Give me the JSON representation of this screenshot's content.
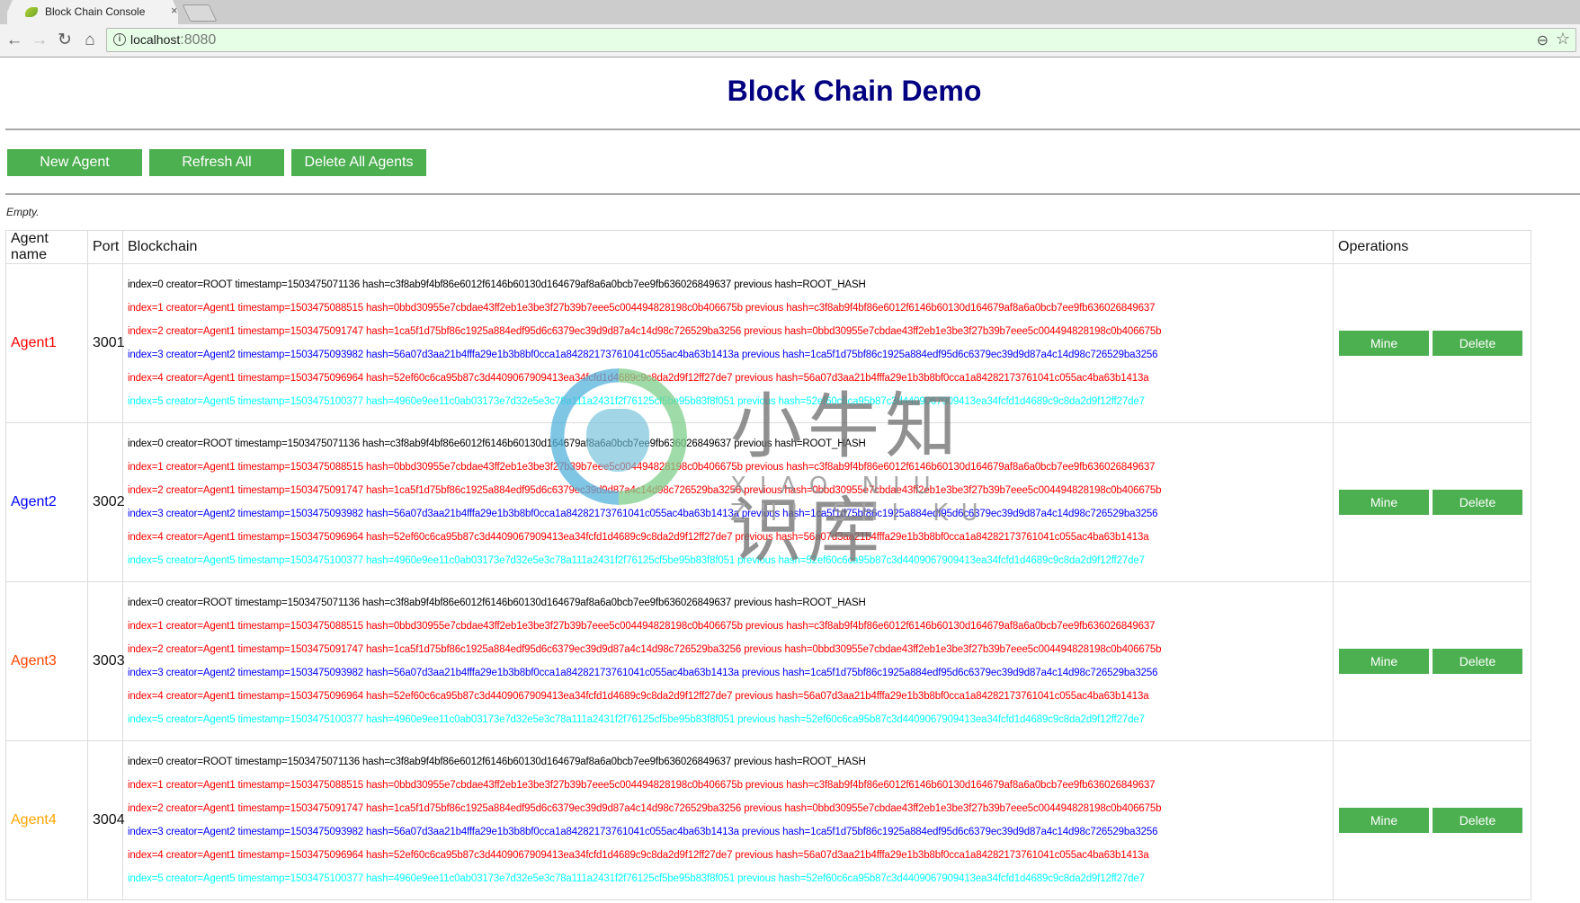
{
  "browser": {
    "tab_title": "Block Chain Console",
    "tab_close": "×",
    "url_host": "localhost",
    "url_port": ":8080",
    "icons": {
      "back": "←",
      "forward": "→",
      "reload": "↻",
      "home": "⌂",
      "info": "i",
      "zoom": "⊖",
      "star": "☆"
    }
  },
  "page": {
    "title": "Block Chain Demo",
    "buttons": {
      "new_agent": "New Agent",
      "refresh_all": "Refresh All",
      "delete_all": "Delete All Agents"
    },
    "status": "Empty."
  },
  "table": {
    "headers": {
      "name": "Agent name",
      "port": "Port",
      "blockchain": "Blockchain",
      "operations": "Operations"
    },
    "ops": {
      "mine": "Mine",
      "delete": "Delete"
    },
    "creator_colors": {
      "ROOT": "#000000",
      "Agent1": "#ff0000",
      "Agent2": "#0000ff",
      "Agent3": "#ff4500",
      "Agent4": "#ffa500",
      "Agent5": "#00ffff"
    },
    "agents": [
      {
        "name": "Agent1",
        "port": "3001",
        "color": "#ff0000"
      },
      {
        "name": "Agent2",
        "port": "3002",
        "color": "#0000ff"
      },
      {
        "name": "Agent3",
        "port": "3003",
        "color": "#ff4500"
      },
      {
        "name": "Agent4",
        "port": "3004",
        "color": "#ffa500"
      }
    ],
    "blockchain": [
      {
        "creator": "ROOT",
        "text": "index=0 creator=ROOT timestamp=1503475071136 hash=c3f8ab9f4bf86e6012f6146b60130d164679af8a6a0bcb7ee9fb636026849637 previous hash=ROOT_HASH"
      },
      {
        "creator": "Agent1",
        "text": "index=1 creator=Agent1 timestamp=1503475088515 hash=0bbd30955e7cbdae43ff2eb1e3be3f27b39b7eee5c004494828198c0b406675b previous hash=c3f8ab9f4bf86e6012f6146b60130d164679af8a6a0bcb7ee9fb636026849637"
      },
      {
        "creator": "Agent1",
        "text": "index=2 creator=Agent1 timestamp=1503475091747 hash=1ca5f1d75bf86c1925a884edf95d6c6379ec39d9d87a4c14d98c726529ba3256 previous hash=0bbd30955e7cbdae43ff2eb1e3be3f27b39b7eee5c004494828198c0b406675b"
      },
      {
        "creator": "Agent2",
        "text": "index=3 creator=Agent2 timestamp=1503475093982 hash=56a07d3aa21b4fffa29e1b3b8bf0cca1a84282173761041c055ac4ba63b1413a previous hash=1ca5f1d75bf86c1925a884edf95d6c6379ec39d9d87a4c14d98c726529ba3256"
      },
      {
        "creator": "Agent1",
        "text": "index=4 creator=Agent1 timestamp=1503475096964 hash=52ef60c6ca95b87c3d4409067909413ea34fcfd1d4689c9c8da2d9f12ff27de7 previous hash=56a07d3aa21b4fffa29e1b3b8bf0cca1a84282173761041c055ac4ba63b1413a"
      },
      {
        "creator": "Agent5",
        "text": "index=5 creator=Agent5 timestamp=1503475100377 hash=4960e9ee11c0ab03173e7d32e5e3c78a111a2431f2f76125cf5be95b83f8f051 previous hash=52ef60c6ca95b87c3d4409067909413ea34fcfd1d4689c9c8da2d9f12ff27de7"
      }
    ]
  },
  "watermark": {
    "cn": "小牛知识库",
    "en": "XIAO NIU ZHI SHI KU"
  }
}
